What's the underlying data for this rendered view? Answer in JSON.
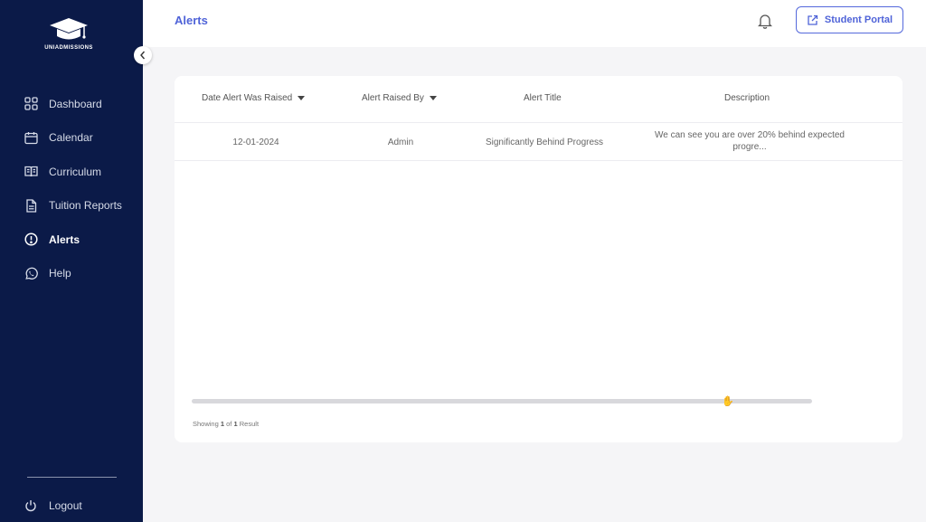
{
  "app": {
    "logo_text": "UNIADMISSIONS"
  },
  "sidebar": {
    "items": [
      {
        "label": "Dashboard",
        "icon": "grid-icon"
      },
      {
        "label": "Calendar",
        "icon": "calendar-icon"
      },
      {
        "label": "Curriculum",
        "icon": "book-icon"
      },
      {
        "label": "Tuition Reports",
        "icon": "document-icon"
      },
      {
        "label": "Alerts",
        "icon": "alert-icon",
        "active": true
      },
      {
        "label": "Help",
        "icon": "whatsapp-icon"
      }
    ],
    "logout_label": "Logout"
  },
  "header": {
    "title": "Alerts",
    "portal_button": "Student Portal"
  },
  "table": {
    "columns": [
      "Date Alert Was Raised",
      "Alert Raised By",
      "Alert Title",
      "Description"
    ],
    "rows": [
      {
        "date": "12-01-2024",
        "raised_by": "Admin",
        "title": "Significantly Behind Progress",
        "description_line1": "We can see you are over 20% behind expected",
        "description_line2": "progre..."
      }
    ]
  },
  "footer": {
    "showing": "Showing",
    "start": "1",
    "of": "of",
    "total": "1",
    "unit": "Result"
  },
  "colors": {
    "sidebar_bg": "#0b1a48",
    "accent": "#4f63d8",
    "page_bg": "#f5f5f7"
  }
}
